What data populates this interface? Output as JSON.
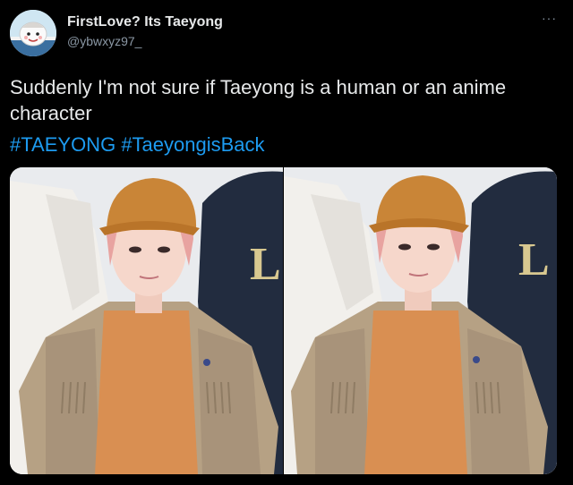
{
  "tweet": {
    "display_name": "FirstLove? Its Taeyong",
    "handle": "@ybwxyz97_",
    "more_label": "···",
    "text": "Suddenly I'm not sure if Taeyong is a human or an anime character",
    "hashtags": [
      "#TAEYONG",
      "#TaeyongisBack"
    ]
  },
  "media": {
    "photos": [
      {
        "letter_on_hoodie": "L"
      },
      {
        "letter_on_hoodie": "L"
      }
    ]
  },
  "colors": {
    "background": "#000000",
    "hashtag": "#1d9bf0",
    "secondary_text": "#8b98a5"
  }
}
